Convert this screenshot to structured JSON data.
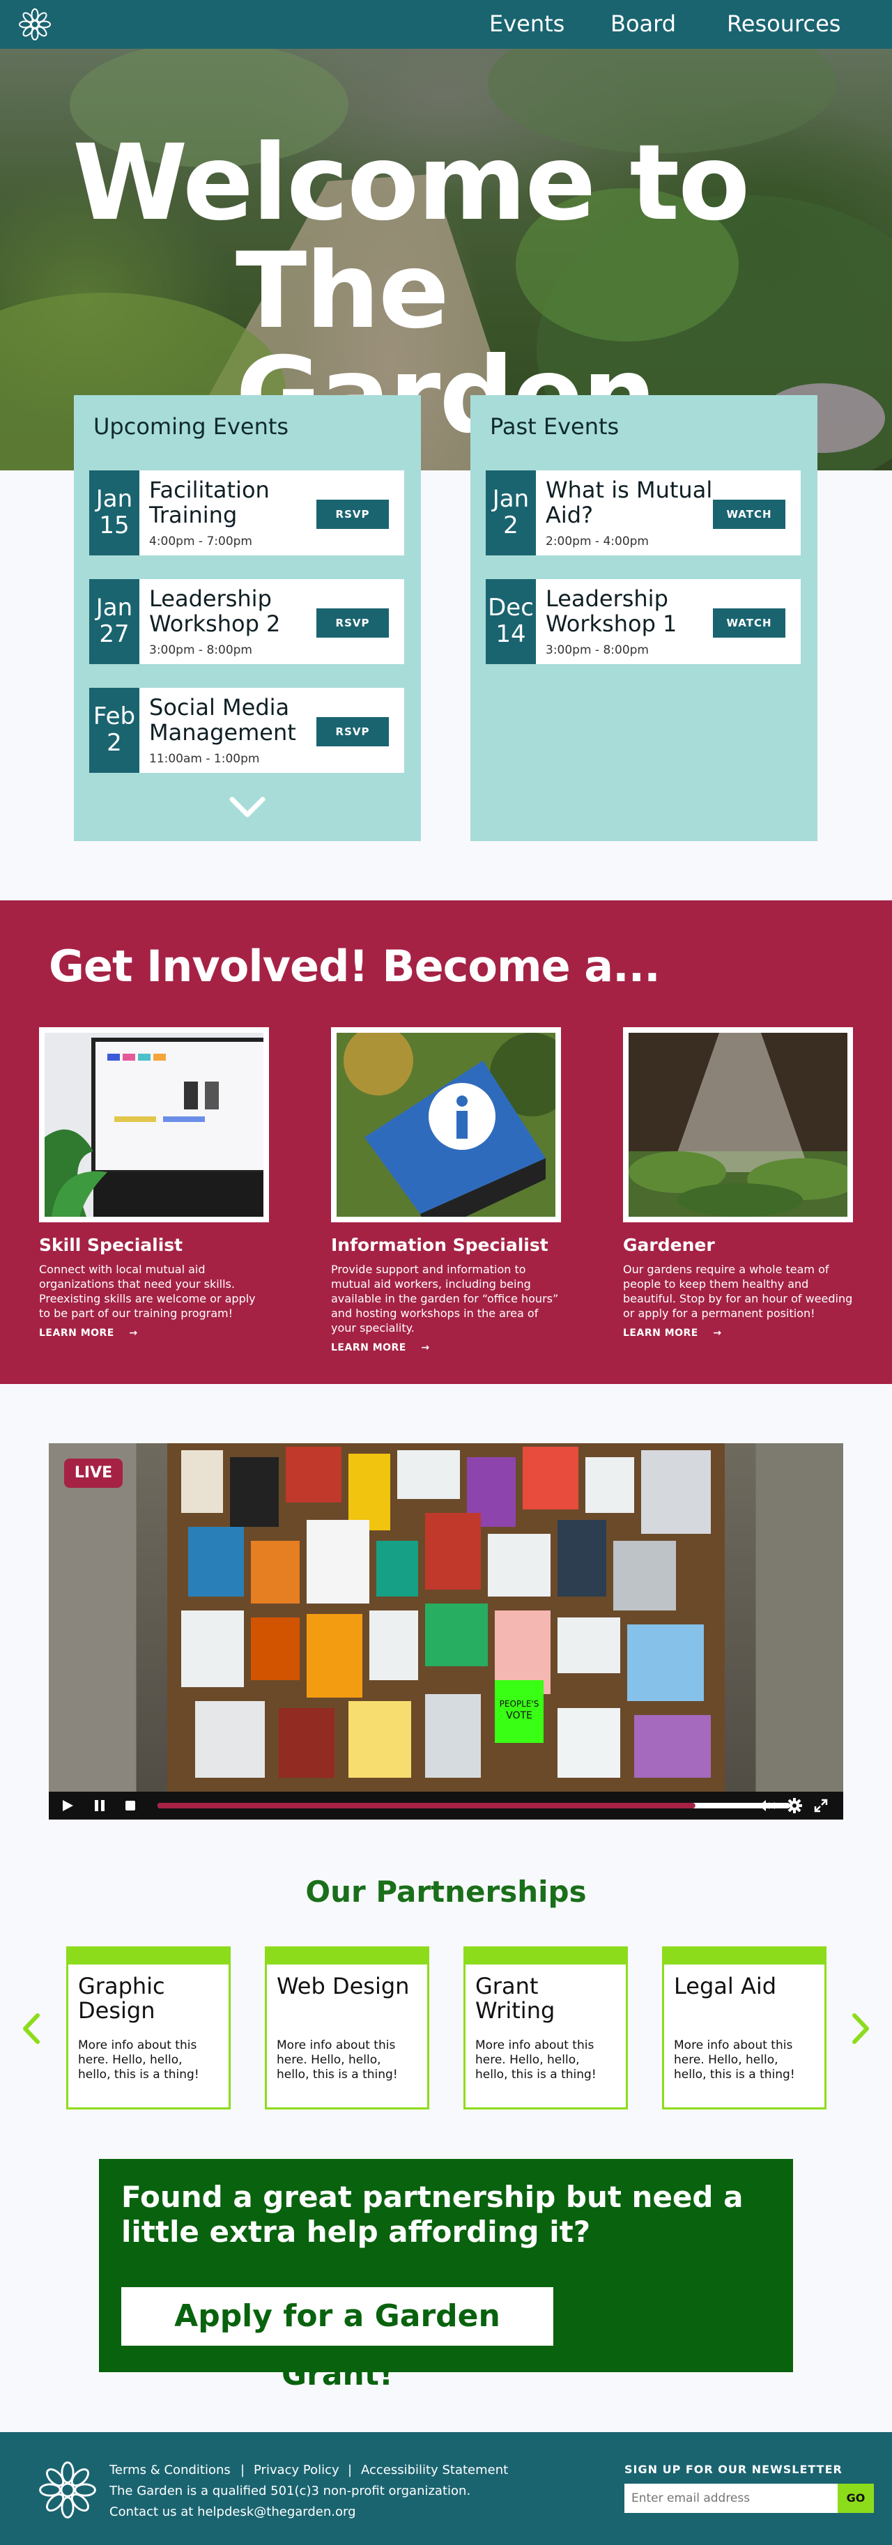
{
  "header": {
    "nav": [
      "Events",
      "Board",
      "Resources"
    ]
  },
  "hero": {
    "title_line1": "Welcome to",
    "title_line2": "The Garden"
  },
  "upcoming": {
    "title": "Upcoming Events",
    "items": [
      {
        "month": "Jan",
        "day": "15",
        "name": "Facilitation Training",
        "time": "4:00pm - 7:00pm",
        "button": "RSVP"
      },
      {
        "month": "Jan",
        "day": "27",
        "name": "Leadership Workshop 2",
        "time": "3:00pm - 8:00pm",
        "button": "RSVP"
      },
      {
        "month": "Feb",
        "day": "2",
        "name": "Social Media Management",
        "time": "11:00am - 1:00pm",
        "button": "RSVP"
      }
    ]
  },
  "past": {
    "title": "Past Events",
    "items": [
      {
        "month": "Jan",
        "day": "2",
        "name": "What is Mutual Aid?",
        "time": "2:00pm - 4:00pm",
        "button": "WATCH"
      },
      {
        "month": "Dec",
        "day": "14",
        "name": "Leadership Workshop 1",
        "time": "3:00pm - 8:00pm",
        "button": "WATCH"
      }
    ]
  },
  "involved": {
    "title": "Get Involved! Become a...",
    "roles": [
      {
        "title": "Skill Specialist",
        "desc": "Connect with local mutual aid organizations that need your skills. Preexisting skills are welcome or apply to be part of our training program!",
        "link": "LEARN MORE"
      },
      {
        "title": "Information Specialist",
        "desc": "Provide support and information to mutual aid workers, including being available in the garden for “office hours” and hosting workshops in the area of your speciality.",
        "link": "LEARN MORE"
      },
      {
        "title": "Gardener",
        "desc": "Our gardens require a whole team of people to keep them healthy and beautiful. Stop by for an hour of weeding or apply for a permanent position!",
        "link": "LEARN MORE"
      }
    ]
  },
  "video": {
    "badge": "LIVE",
    "progress": 0.85,
    "poster_text_1": "PEOPLE'S",
    "poster_text_2": "VOTE"
  },
  "partnerships": {
    "title": "Our Partnerships",
    "cards": [
      {
        "title": "Graphic Design",
        "desc": "More info about this here. Hello, hello, hello, this is a thing!"
      },
      {
        "title": "Web Design",
        "desc": "More info about this here. Hello, hello, hello, this is a thing!"
      },
      {
        "title": "Grant Writing",
        "desc": "More info about this here. Hello, hello, hello, this is a thing!"
      },
      {
        "title": "Legal Aid",
        "desc": "More info about this here. Hello, hello, hello, this is a thing!"
      }
    ]
  },
  "grant": {
    "text": "Found a great partnership but need a little extra help affording it?",
    "button": "Apply for a Garden Grant!"
  },
  "footer": {
    "links": [
      "Terms & Conditions",
      "Privacy Policy",
      "Accessibility Statement"
    ],
    "separator": "|",
    "line2": "The Garden is a qualified 501(c)3 non-profit organization.",
    "line3": "Contact us at helpdesk@thegarden.org",
    "newsletter_label": "SIGN UP FOR OUR NEWSLETTER",
    "newsletter_placeholder": "Enter email address",
    "newsletter_button": "GO"
  },
  "colors": {
    "teal": "#1a6470",
    "mint": "#a8dcd8",
    "crimson": "#a52245",
    "lime": "#8ddc1c",
    "forest": "#09620e"
  }
}
